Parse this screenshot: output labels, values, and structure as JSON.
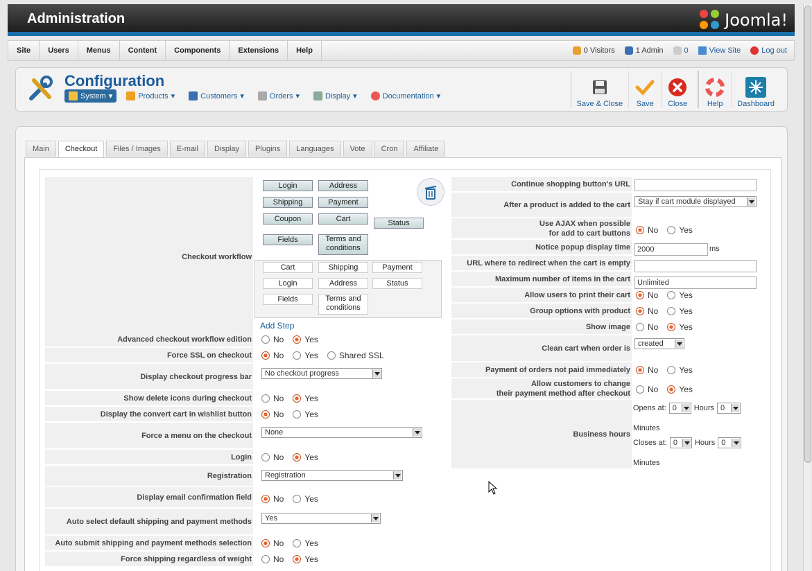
{
  "header": {
    "title": "Administration",
    "logo": "Joomla!"
  },
  "menu": [
    "Site",
    "Users",
    "Menus",
    "Content",
    "Components",
    "Extensions",
    "Help"
  ],
  "status": {
    "visitors": "0 Visitors",
    "admins": "1 Admin",
    "messages": "0",
    "view_site": "View Site",
    "logout": "Log out"
  },
  "toolbar": {
    "title": "Configuration",
    "subnav": [
      {
        "label": "System",
        "active": true
      },
      {
        "label": "Products"
      },
      {
        "label": "Customers"
      },
      {
        "label": "Orders"
      },
      {
        "label": "Display"
      },
      {
        "label": "Documentation"
      }
    ],
    "buttons": [
      "Save & Close",
      "Save",
      "Close",
      "Help",
      "Dashboard"
    ]
  },
  "tabs": [
    "Main",
    "Checkout",
    "Files / Images",
    "E-mail",
    "Display",
    "Plugins",
    "Languages",
    "Vote",
    "Cron",
    "Affiliate"
  ],
  "left": {
    "checkout_workflow": "Checkout workflow",
    "wf_top": [
      "Login",
      "Address",
      "Shipping",
      "Payment",
      "Coupon",
      "Cart",
      "Status",
      "Fields",
      "Terms and conditions"
    ],
    "wf_bottom": [
      "Cart",
      "Shipping",
      "Payment",
      "Login",
      "Address",
      "Status",
      "Fields",
      "Terms and conditions"
    ],
    "add_step": "Add Step",
    "rows": [
      {
        "label": "Advanced checkout workflow edition",
        "options": [
          "No",
          "Yes"
        ],
        "selected": "Yes"
      },
      {
        "label": "Force SSL on checkout",
        "options": [
          "No",
          "Yes",
          "Shared SSL"
        ],
        "selected": "No"
      },
      {
        "label": "Display checkout progress bar",
        "select": "No checkout progress"
      },
      {
        "label": "Show delete icons during checkout",
        "options": [
          "No",
          "Yes"
        ],
        "selected": "Yes"
      },
      {
        "label": "Display the convert cart in wishlist button",
        "options": [
          "No",
          "Yes"
        ],
        "selected": "No"
      },
      {
        "label": "Force a menu on the checkout",
        "select": "None"
      },
      {
        "label": "Login",
        "options": [
          "No",
          "Yes"
        ],
        "selected": "Yes"
      },
      {
        "label": "Registration",
        "select": "Registration"
      },
      {
        "label": "Display email confirmation field",
        "options": [
          "No",
          "Yes"
        ],
        "selected": "No"
      },
      {
        "label": "Auto select default shipping and payment methods",
        "select": "Yes"
      },
      {
        "label": "Auto submit shipping and payment methods selection",
        "options": [
          "No",
          "Yes"
        ],
        "selected": "No"
      },
      {
        "label": "Force shipping regardless of weight",
        "options": [
          "No",
          "Yes"
        ],
        "selected": "Yes"
      }
    ]
  },
  "right": {
    "continue_url": {
      "label": "Continue shopping button's URL",
      "value": ""
    },
    "after_add": {
      "label": "After a product is added to the cart",
      "select": "Stay if cart module displayed"
    },
    "ajax": {
      "label1": "Use AJAX when possible",
      "label2": "for add to cart buttons",
      "selected": "No"
    },
    "popup": {
      "label": "Notice popup display time",
      "value": "2000",
      "unit": "ms"
    },
    "redirect": {
      "label": "URL where to redirect when the cart is empty",
      "value": ""
    },
    "max_items": {
      "label": "Maximum number of items in the cart",
      "value": "Unlimited"
    },
    "print": {
      "label": "Allow users to print their cart",
      "selected": "No"
    },
    "group": {
      "label": "Group options with product",
      "selected": "No"
    },
    "show_image": {
      "label": "Show image",
      "selected": "Yes"
    },
    "clean": {
      "label": "Clean cart when order is",
      "select": "created"
    },
    "payment_unpaid": {
      "label": "Payment of orders not paid immediately",
      "selected": "No"
    },
    "change_payment": {
      "label1": "Allow customers to change",
      "label2": "their payment method after checkout",
      "selected": "Yes"
    },
    "business": {
      "label": "Business hours",
      "opens": "Opens at:",
      "closes": "Closes at:",
      "hours": "Hours",
      "minutes": "Minutes",
      "h": "0",
      "m": "0"
    },
    "no": "No",
    "yes": "Yes"
  }
}
